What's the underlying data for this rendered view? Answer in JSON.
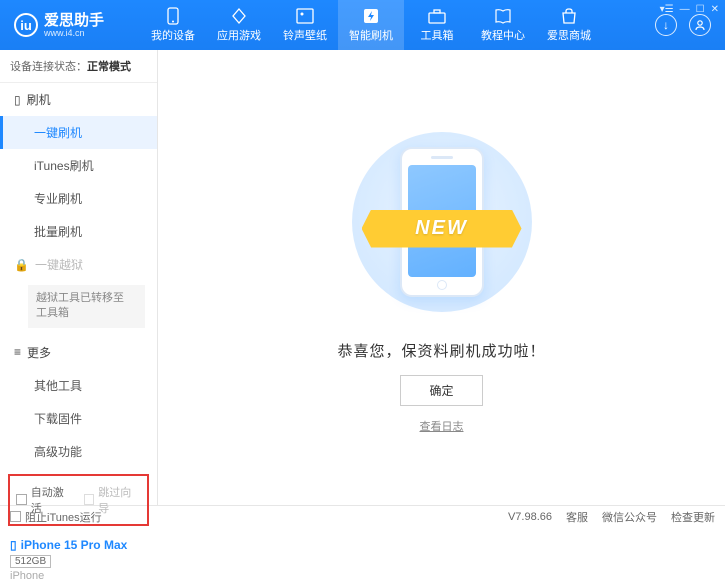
{
  "app": {
    "name": "爱思助手",
    "site": "www.i4.cn"
  },
  "topnav": [
    {
      "label": "我的设备"
    },
    {
      "label": "应用游戏"
    },
    {
      "label": "铃声壁纸"
    },
    {
      "label": "智能刷机",
      "active": true
    },
    {
      "label": "工具箱"
    },
    {
      "label": "教程中心"
    },
    {
      "label": "爱思商城"
    }
  ],
  "conn": {
    "prefix": "设备连接状态：",
    "mode": "正常模式"
  },
  "sidebar": {
    "flash_head": "刷机",
    "flash_items": [
      "一键刷机",
      "iTunes刷机",
      "专业刷机",
      "批量刷机"
    ],
    "jailbreak_head": "一键越狱",
    "jailbreak_note": "越狱工具已转移至\n工具箱",
    "more_head": "更多",
    "more_items": [
      "其他工具",
      "下载固件",
      "高级功能"
    ],
    "check_auto_activate": "自动激活",
    "check_skip_guide": "跳过向导"
  },
  "device": {
    "name": "iPhone 15 Pro Max",
    "storage": "512GB",
    "type": "iPhone"
  },
  "content": {
    "ribbon": "NEW",
    "success": "恭喜您，保资料刷机成功啦！",
    "ok": "确定",
    "log": "查看日志"
  },
  "statusbar": {
    "block_itunes": "阻止iTunes运行",
    "version": "V7.98.66",
    "links": [
      "客服",
      "微信公众号",
      "检查更新"
    ]
  }
}
